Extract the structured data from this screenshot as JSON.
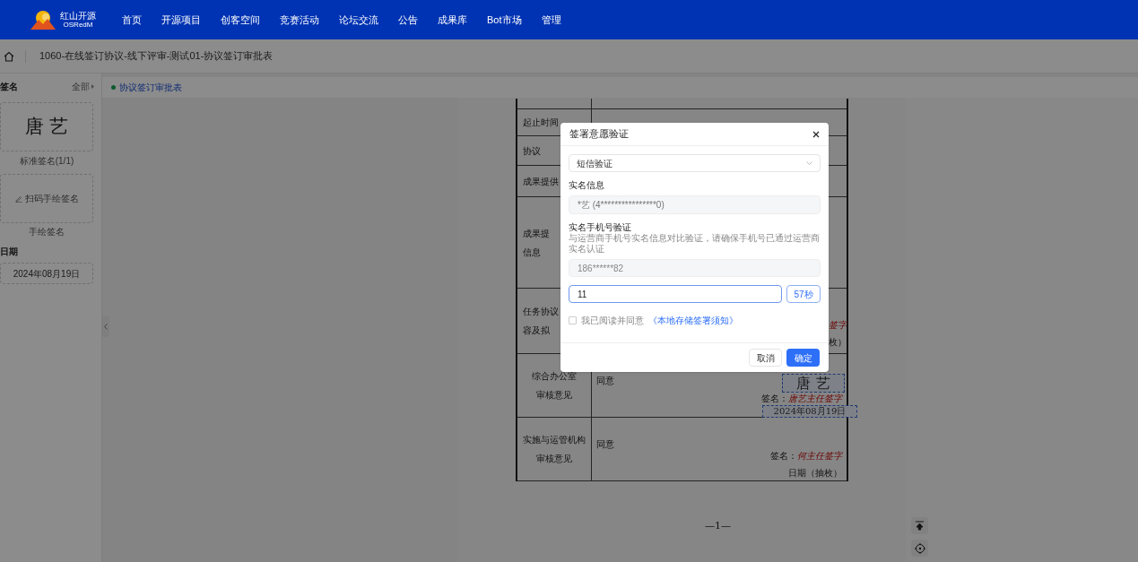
{
  "nav": {
    "logo_title": "红山开源",
    "logo_subtitle": "OSRedM",
    "items": [
      {
        "label": "首页"
      },
      {
        "label": "开源项目"
      },
      {
        "label": "创客空间"
      },
      {
        "label": "竞赛活动"
      },
      {
        "label": "论坛交流"
      },
      {
        "label": "公告"
      },
      {
        "label": "成果库"
      },
      {
        "label": "Bot市场"
      },
      {
        "label": "管理"
      }
    ]
  },
  "breadcrumb": {
    "title": "1060-在线签订协议-线下评审-测试01-协议签订审批表"
  },
  "sidebar": {
    "signature_heading": "签名",
    "filter": "全部",
    "standard_signature": "唐 艺",
    "standard_caption": "标准签名(1/1)",
    "handdrawn_action": "扫码手绘签名",
    "handdrawn_caption": "手绘签名",
    "date_heading": "日期",
    "date_value": "2024年08月19日"
  },
  "doc_tabs": [
    {
      "label": "协议签订审批表",
      "selected": true
    }
  ],
  "document": {
    "rows": [
      {
        "label_lines": []
      },
      {
        "label_lines": [
          "起止时间"
        ]
      },
      {
        "label_lines": [
          "协议"
        ]
      },
      {
        "label_lines": [
          "成果提供"
        ]
      },
      {
        "label_lines": [
          "成果提",
          "信息"
        ]
      },
      {
        "label_lines": [
          "任务协议",
          "容及拟"
        ],
        "right_texts": [
          {
            "text": "签字",
            "kind": "signer"
          },
          {
            "text": "枚）",
            "kind": "plain"
          }
        ]
      },
      {
        "label_lines": [
          "综合办公室",
          "审核意见"
        ],
        "opinion": "同意",
        "signature_image": "唐 艺",
        "signer_prefix": "签名：",
        "signer": "唐艺主任签字",
        "date_stamp": "2024年08月19日"
      },
      {
        "label_lines": [
          "实施与运管机构",
          "审核意见"
        ],
        "opinion": "同意",
        "signer_prefix": "签名：",
        "signer": "何主任签字",
        "date_label": "日期（抽枚）"
      }
    ],
    "page_number": "—1—"
  },
  "dialog": {
    "title": "签署意愿验证",
    "method": "短信验证",
    "realname_label": "实名信息",
    "realname_value": "*艺 (4****************0)",
    "phone_label": "实名手机号验证",
    "phone_hint": "与运营商手机号实名信息对比验证，请确保手机号已通过运营商实名认证",
    "phone_value": "186******82",
    "code_value": "11",
    "countdown": "57秒",
    "agree_checked": false,
    "agree_text": "我已阅读并同意",
    "agree_link": "《本地存储签署须知》",
    "cancel": "取消",
    "confirm": "确定"
  }
}
